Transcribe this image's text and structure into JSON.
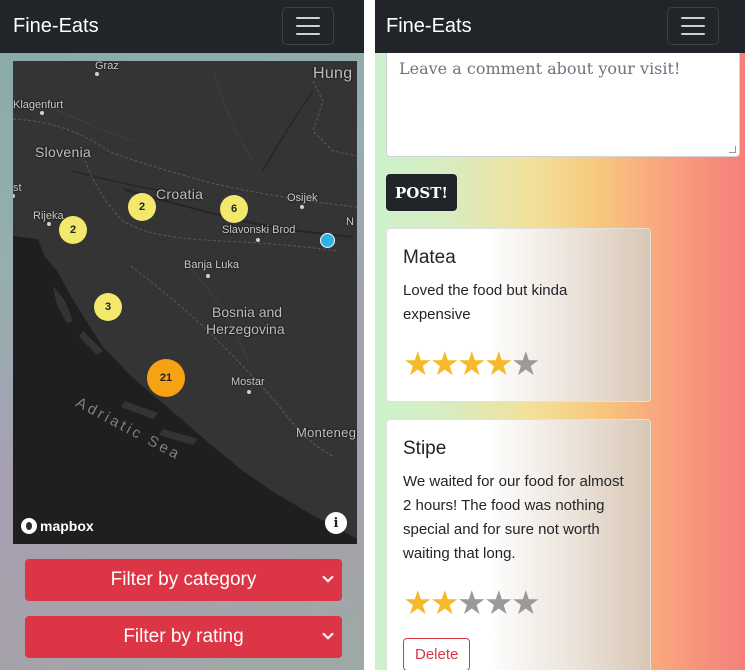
{
  "left": {
    "navbar": {
      "brand": "Fine-Eats"
    },
    "map": {
      "labels": {
        "graz": "Graz",
        "hung": "Hung",
        "klagenfurt": "Klagenfurt",
        "slovenia": "Slovenia",
        "st": "st",
        "croatia": "Croatia",
        "osijek": "Osijek",
        "rijeka": "Rijeka",
        "n": "N",
        "slavonski_brod": "Slavonski Brod",
        "banja_luka": "Banja Luka",
        "bosnia_line1": "Bosnia and",
        "bosnia_line2": "Herzegovina",
        "mostar": "Mostar",
        "adriatic_sea": "Adriatic Sea",
        "montenegro": "Montenegro"
      },
      "clusters": {
        "croatia_north": "2",
        "rijeka": "2",
        "slavonia": "6",
        "dalmatia": "3",
        "south_coast": "21"
      },
      "attribution": {
        "logo": "mapbox",
        "info": "i"
      },
      "colors": {
        "cluster_small": "#f2e86b",
        "cluster_large": "#f6a213",
        "marker": "#2eb3e6"
      }
    },
    "filters": {
      "category": "Filter by category",
      "rating": "Filter by rating"
    }
  },
  "right": {
    "navbar": {
      "brand": "Fine-Eats"
    },
    "comment": {
      "placeholder": "Leave a comment about your visit!"
    },
    "post_label": "POST!",
    "reviews": [
      {
        "author": "Matea",
        "text": "Loved the food but kinda expensive",
        "rating": 4,
        "max": 5
      },
      {
        "author": "Stipe",
        "text": "We waited for our food for almost 2 hours! The food was nothing special and for sure not worth waiting that long.",
        "rating": 2,
        "max": 5,
        "delete_label": "Delete"
      }
    ]
  }
}
